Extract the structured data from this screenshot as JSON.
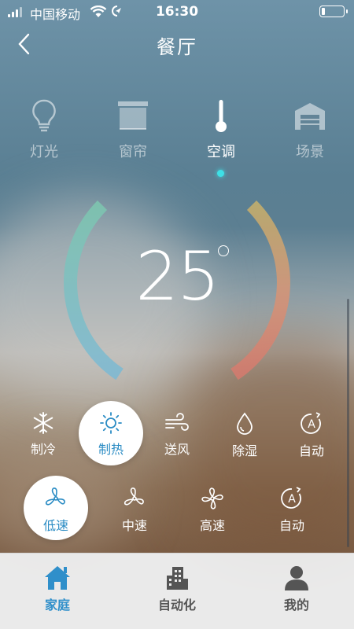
{
  "status": {
    "carrier": "中国移动",
    "time": "16:30",
    "signal_bars": 4,
    "battery_level": 0.15
  },
  "header": {
    "title": "餐厅"
  },
  "categories": [
    {
      "label": "灯光",
      "icon": "bulb-icon",
      "active": false
    },
    {
      "label": "窗帘",
      "icon": "curtain-icon",
      "active": false
    },
    {
      "label": "空调",
      "icon": "thermometer-icon",
      "active": true
    },
    {
      "label": "场景",
      "icon": "garage-icon",
      "active": false
    }
  ],
  "thermostat": {
    "temperature": "25",
    "unit_symbol": "°",
    "arc_colors": [
      "#7dc7b0",
      "#7bb9d4",
      "#c9b16a",
      "#d67a6e"
    ]
  },
  "modes": [
    {
      "label": "制冷",
      "icon": "snowflake-icon",
      "selected": false
    },
    {
      "label": "制热",
      "icon": "sun-icon",
      "selected": true
    },
    {
      "label": "送风",
      "icon": "wind-icon",
      "selected": false
    },
    {
      "label": "除湿",
      "icon": "droplet-icon",
      "selected": false
    },
    {
      "label": "自动",
      "icon": "auto-icon",
      "selected": false
    }
  ],
  "fan_speeds": [
    {
      "label": "低速",
      "icon": "fan-icon",
      "selected": true
    },
    {
      "label": "中速",
      "icon": "fan-icon",
      "selected": false
    },
    {
      "label": "高速",
      "icon": "fan-icon",
      "selected": false
    },
    {
      "label": "自动",
      "icon": "auto-icon",
      "selected": false
    }
  ],
  "tabbar": [
    {
      "label": "家庭",
      "icon": "home-icon",
      "active": true
    },
    {
      "label": "自动化",
      "icon": "building-icon",
      "active": false
    },
    {
      "label": "我的",
      "icon": "user-icon",
      "active": false
    }
  ],
  "colors": {
    "accent": "#2f8fca",
    "indicator": "#3ee0e6"
  }
}
